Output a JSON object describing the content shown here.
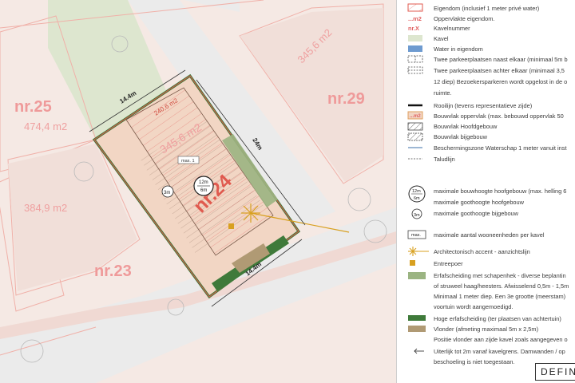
{
  "map": {
    "lots": [
      {
        "number": "nr.25",
        "area": "474,4 m2"
      },
      {
        "number": "nr.29",
        "area": "345,6 m2"
      },
      {
        "number": "nr.23",
        "area": "384,9 m2"
      }
    ],
    "plot": {
      "number": "nr.24",
      "area": "345,6 m2",
      "building_area": "240,6 m2",
      "max_label": "max. 1",
      "height_main": {
        "top": "12m",
        "bottom": "6m"
      },
      "height_annex": "3m"
    },
    "dimensions": {
      "top": "14.4m",
      "side": "24m",
      "bottom": "14.4m"
    }
  },
  "legend": {
    "items": [
      {
        "key": "ownership",
        "text": "Eigendom (inclusief 1 meter privé water)"
      },
      {
        "key": "area_code",
        "code": "...m2",
        "text": "Oppervlakte eigendom."
      },
      {
        "key": "lot_code",
        "code": "nr.X",
        "text": "Kavelnummer"
      },
      {
        "key": "lot",
        "text": "Kavel"
      },
      {
        "key": "water",
        "text": "Water in eigendom"
      },
      {
        "key": "parking_side",
        "text": "Twee parkeerplaatsen naast elkaar (minimaal 5m b"
      },
      {
        "key": "parking_behind",
        "lines": [
          "Twee parkeerplaatsen achter elkaar (minimaal 3,5",
          "12 diep) Bezoekersparkeren wordt opgelost in de o",
          "ruimte."
        ]
      },
      {
        "key": "building_line",
        "text": "Rooilijn (tevens representatieve zijde)"
      },
      {
        "key": "building_area",
        "code": "...m2",
        "text": "Bouwvlak oppervlak (max. bebouwd oppervlak 50"
      },
      {
        "key": "main_building",
        "text": "Bouwvlak Hoofdgebouw"
      },
      {
        "key": "annex",
        "text": "Bouwvlak bijgebouw"
      },
      {
        "key": "protection_zone",
        "text": "Beschermingszone Waterschap 1 meter vanuit inst"
      },
      {
        "key": "slope",
        "text": "Taludlijn"
      },
      {
        "key": "max_height_main",
        "badge": [
          "12m",
          "6m"
        ],
        "text": "maximale bouwhoogte hoofgebouw (max. helling 6"
      },
      {
        "key": "gutter_main",
        "text": "maximale goothoogte hoofgebouw"
      },
      {
        "key": "gutter_annex",
        "badge": [
          "3m"
        ],
        "text": "maximale goothoogte bijgebouw"
      },
      {
        "key": "max_units",
        "badge": [
          "max."
        ],
        "text": "maximale aantal wooneenheden per kavel"
      },
      {
        "key": "accent",
        "text": "Architectonisch accent - aanzichtslijn"
      },
      {
        "key": "entrance",
        "text": "Entreepoer"
      },
      {
        "key": "hedge",
        "lines": [
          "Erfafscheiding met schapenhek - diverse beplantin",
          "of struweel haag/heesters. Afwisselend 0,5m - 1,5m",
          "Minimaal 1 meter diep. Een 3e grootte (meerstam)",
          "voortuin wordt aangemoedigd."
        ]
      },
      {
        "key": "high_fence",
        "text": "Hoge erfafscheiding (ter plaatsen van achtertuin)"
      },
      {
        "key": "deck",
        "lines": [
          "Vlonder (afmeting maximaal 5m x 2,5m)",
          "Positie vlonder aan zijde kavel zoals aangegeven o"
        ]
      },
      {
        "key": "limit",
        "lines": [
          "Uiterlijk tot 2m vanaf kavelgrens. Damwanden / op",
          "beschoeling is niet toegestaan."
        ]
      }
    ],
    "footer": "DEFINI"
  },
  "colors": {
    "lot_fill": "#f5e9e4",
    "road": "#ebebeb",
    "green": "#dde6cf",
    "plot_fill": "#f2d6c4",
    "boundary_red": "#e05a4f",
    "hedge_green": "#3f7a3a",
    "accent_gold": "#d8a020",
    "water_blue": "#6e9bd0",
    "deck_brown": "#b09a74"
  }
}
